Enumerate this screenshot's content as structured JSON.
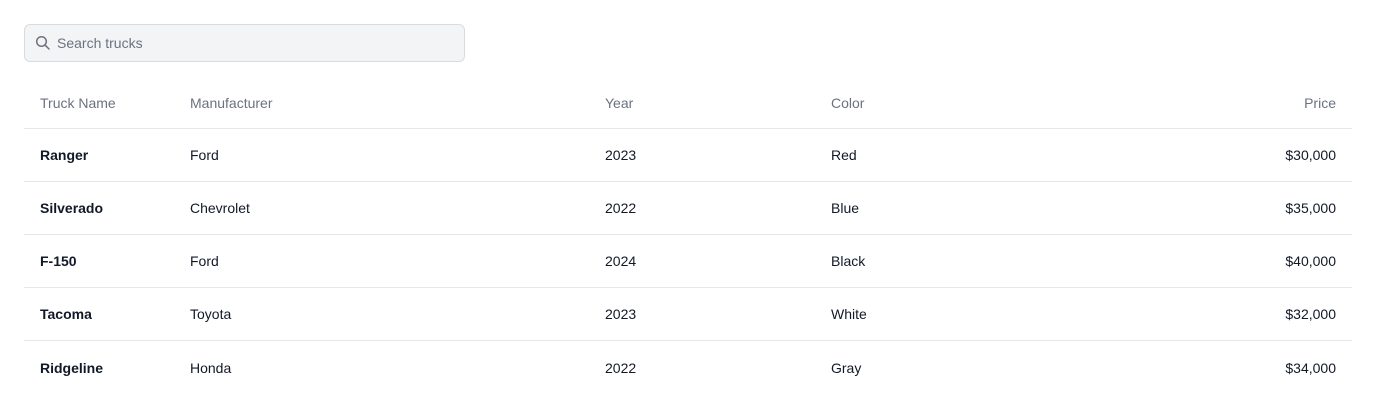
{
  "search": {
    "placeholder": "Search trucks",
    "value": ""
  },
  "table": {
    "headers": {
      "name": "Truck Name",
      "manufacturer": "Manufacturer",
      "year": "Year",
      "color": "Color",
      "price": "Price"
    },
    "rows": [
      {
        "name": "Ranger",
        "manufacturer": "Ford",
        "year": "2023",
        "color": "Red",
        "price": "$30,000"
      },
      {
        "name": "Silverado",
        "manufacturer": "Chevrolet",
        "year": "2022",
        "color": "Blue",
        "price": "$35,000"
      },
      {
        "name": "F-150",
        "manufacturer": "Ford",
        "year": "2024",
        "color": "Black",
        "price": "$40,000"
      },
      {
        "name": "Tacoma",
        "manufacturer": "Toyota",
        "year": "2023",
        "color": "White",
        "price": "$32,000"
      },
      {
        "name": "Ridgeline",
        "manufacturer": "Honda",
        "year": "2022",
        "color": "Gray",
        "price": "$34,000"
      }
    ]
  }
}
